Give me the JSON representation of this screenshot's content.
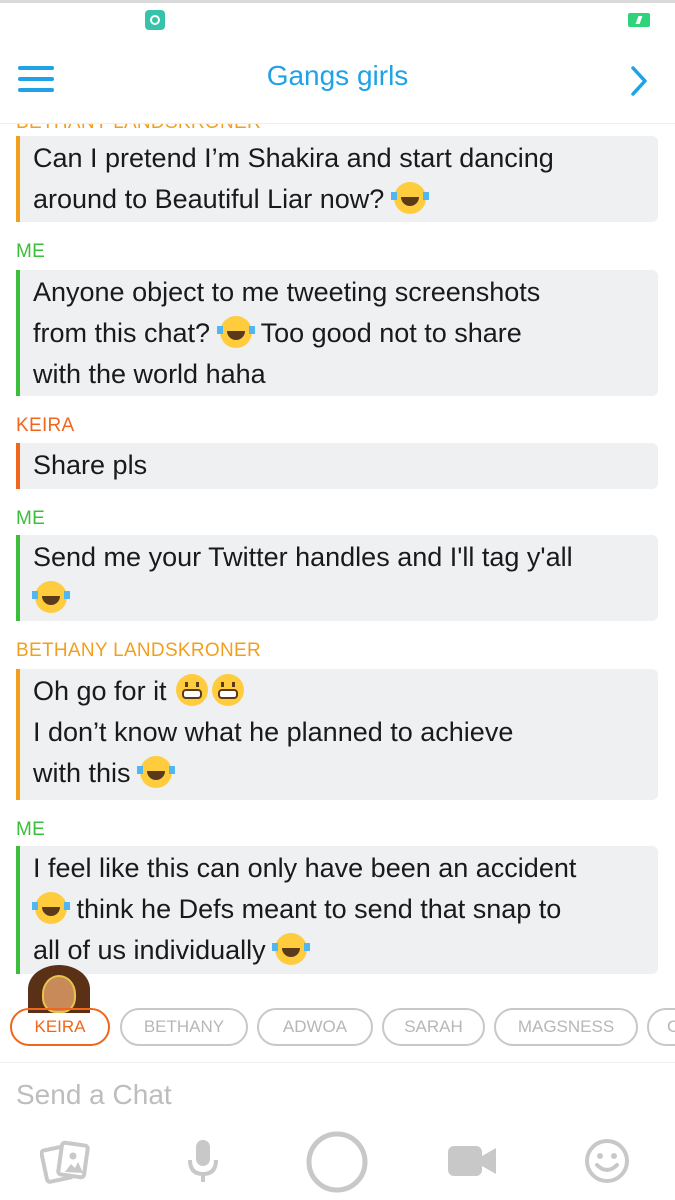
{
  "header": {
    "title": "Gangs girls"
  },
  "colors": {
    "accent": "#1fa3e6",
    "me": "#3cbd3c",
    "keira": "#f0661c",
    "bethany": "#f39f1e",
    "bubble": "#eef0f2"
  },
  "messages": {
    "m0": {
      "sender": "BETHANY LANDSKRONER",
      "line1": "Can I pretend I’m Shakira and start dancing",
      "line2": "around to Beautiful Liar now?"
    },
    "m1": {
      "sender": "ME",
      "line1": "Anyone object to me tweeting screenshots",
      "line2a": "from this chat?",
      "line2b": "Too good not to share",
      "line3": "with the world haha"
    },
    "m2": {
      "sender": "KEIRA",
      "line1": "Share pls"
    },
    "m3": {
      "sender": "ME",
      "line1": "Send me your Twitter handles and I'll tag y'all"
    },
    "m4": {
      "sender": "BETHANY LANDSKRONER",
      "line1": "Oh go for it",
      "line2": "I don’t know what he planned to achieve",
      "line3": "with this"
    },
    "m5": {
      "sender": "ME",
      "line1": "I feel like this can only have been an accident",
      "line2": "think he Defs meant to send that snap to",
      "line3": "all of us individually"
    }
  },
  "chips": [
    "KEIRA",
    "BETHANY",
    "ADWOA",
    "SARAH",
    "MAGSNESS",
    "C"
  ],
  "input": {
    "placeholder": "Send a Chat"
  },
  "icons": [
    "menu-icon",
    "chevron-right-icon",
    "memories-icon",
    "microphone-icon",
    "capture-button-icon",
    "video-icon",
    "emoji-icon",
    "tears-of-joy-emoji",
    "grimacing-emoji"
  ]
}
